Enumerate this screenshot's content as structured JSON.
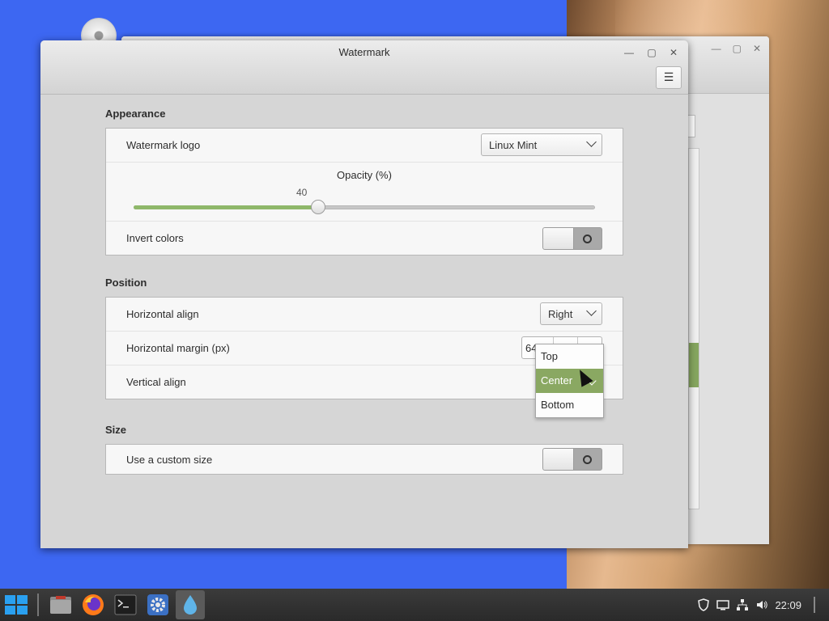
{
  "window": {
    "title": "Watermark",
    "minimize_glyph": "—",
    "maximize_glyph": "▢",
    "close_glyph": "✕",
    "menu_glyph": "☰"
  },
  "appearance": {
    "section_title": "Appearance",
    "logo_label": "Watermark logo",
    "logo_value": "Linux Mint",
    "opacity_title": "Opacity (%)",
    "opacity_value": "40",
    "opacity_fraction": 0.4,
    "invert_label": "Invert colors",
    "invert_on": false
  },
  "position": {
    "section_title": "Position",
    "horizontal_align_label": "Horizontal align",
    "horizontal_align_value": "Right",
    "horizontal_margin_label": "Horizontal margin (px)",
    "horizontal_margin_value": "64",
    "vertical_align_label": "Vertical align",
    "vertical_align_options": [
      "Top",
      "Center",
      "Bottom"
    ],
    "vertical_align_selected": "Center"
  },
  "size": {
    "section_title": "Size",
    "custom_size_label": "Use a custom size",
    "custom_size_on": false
  },
  "taskbar": {
    "clock": "22:09",
    "apps": [
      "menu-icon",
      "files-icon",
      "firefox-icon",
      "terminal-icon",
      "settings-icon",
      "drop-icon"
    ]
  },
  "colors": {
    "accent": "#8aa862",
    "wallpaper": "#3d67f2"
  }
}
